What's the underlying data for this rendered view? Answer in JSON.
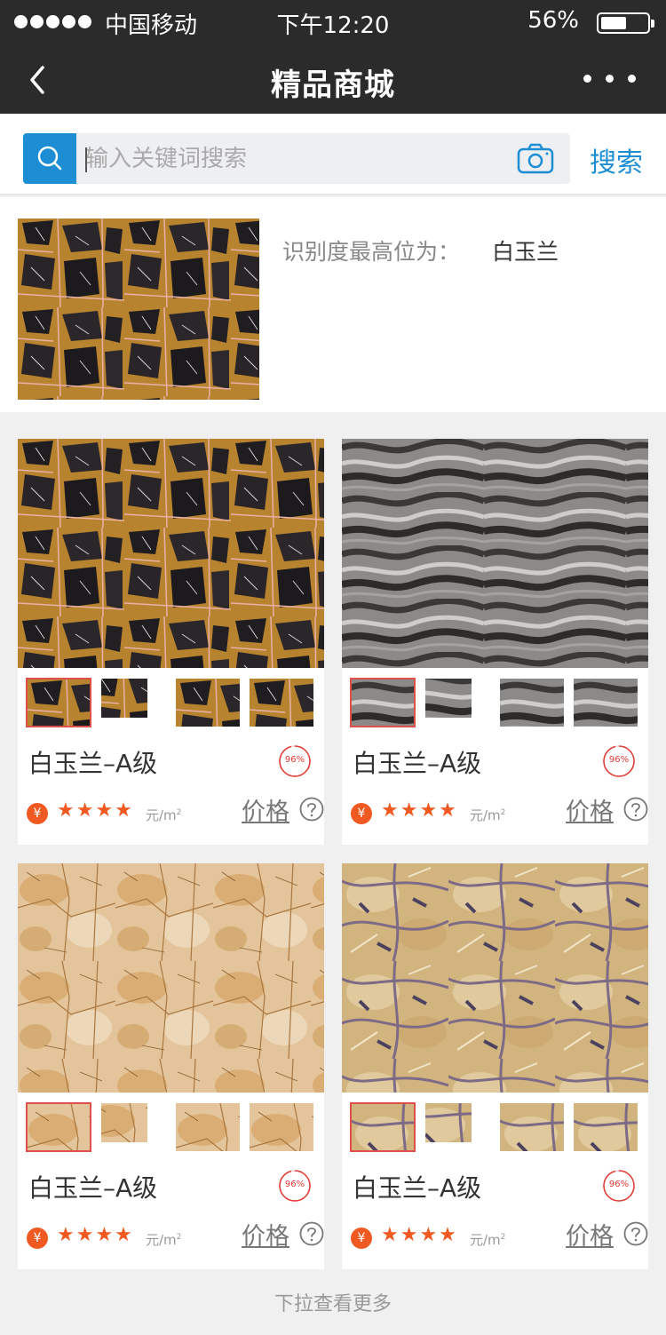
{
  "status_bar": {
    "carrier": "中国移动",
    "time": "下午12:20",
    "battery": "56%",
    "battery_level": 0.56
  },
  "nav": {
    "title": "精品商城",
    "back_icon": "chevron-left-icon",
    "more_icon": "more-dots-icon"
  },
  "search": {
    "placeholder": "输入关键词搜索",
    "button_label": "搜索",
    "icon": "search-icon",
    "camera_icon": "camera-icon"
  },
  "recognition": {
    "label": "识别度最高位为：",
    "value": "白玉兰"
  },
  "colors": {
    "accent_blue": "#1d8ed3",
    "accent_orange": "#f05a22",
    "badge_red": "#e03a33",
    "nav_bg": "#2b2b2b"
  },
  "products": [
    {
      "name": "白玉兰–A级",
      "match": "96%",
      "match_value": 0.96,
      "stars": "★★★★",
      "rating": 4,
      "unit": "元/m",
      "unit_sup": "2",
      "price_label": "价格",
      "texture": "dark-gold"
    },
    {
      "name": "白玉兰–A级",
      "match": "96%",
      "match_value": 0.96,
      "stars": "★★★★",
      "rating": 4,
      "unit": "元/m",
      "unit_sup": "2",
      "price_label": "价格",
      "texture": "grey-wave"
    },
    {
      "name": "白玉兰–A级",
      "match": "96%",
      "match_value": 0.96,
      "stars": "★★★★",
      "rating": 4,
      "unit": "元/m",
      "unit_sup": "2",
      "price_label": "价格",
      "texture": "beige-gold"
    },
    {
      "name": "白玉兰–A级",
      "match": "96%",
      "match_value": 0.96,
      "stars": "★★★★",
      "rating": 4,
      "unit": "元/m",
      "unit_sup": "2",
      "price_label": "价格",
      "texture": "sand-purple"
    }
  ],
  "footer": {
    "load_more": "下拉查看更多"
  }
}
